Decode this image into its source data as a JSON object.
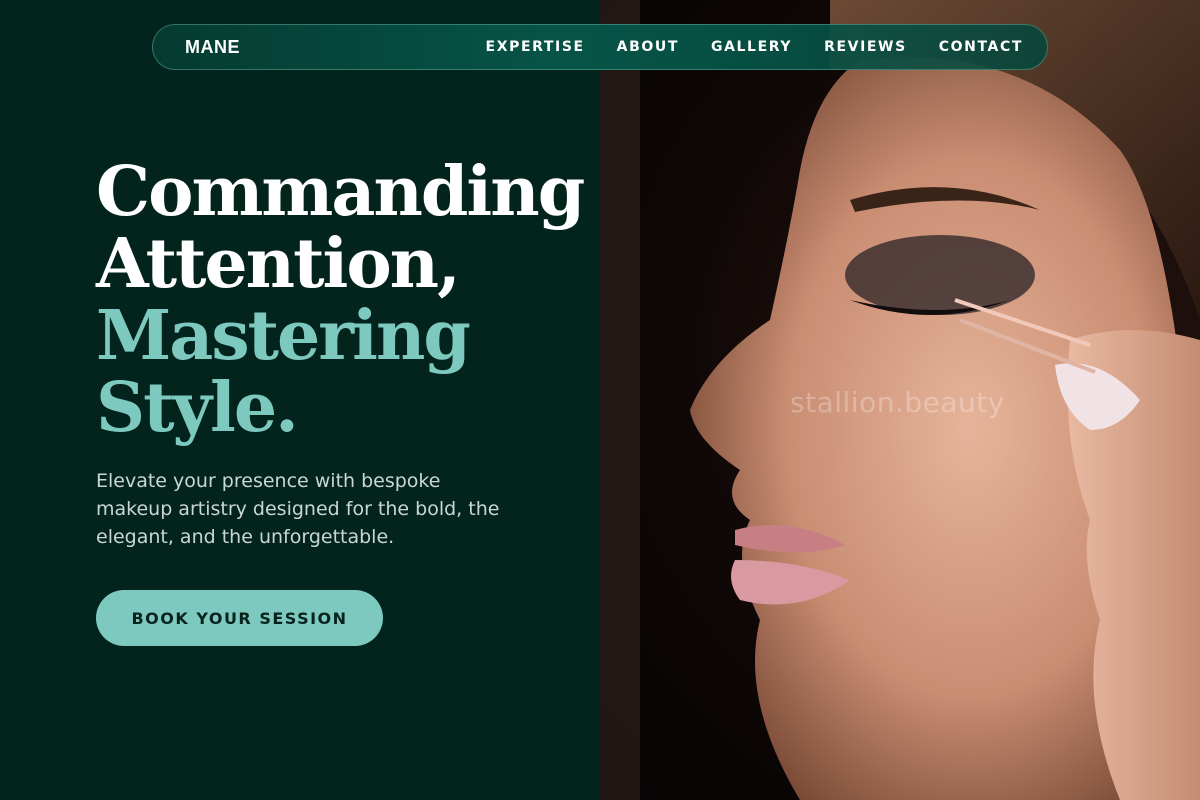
{
  "brand": {
    "name": "MANE"
  },
  "nav": {
    "links": [
      "EXPERTISE",
      "ABOUT",
      "GALLERY",
      "REVIEWS",
      "CONTACT"
    ]
  },
  "hero": {
    "headline_lines": {
      "line1": "Commanding",
      "line2": "Attention,",
      "line3": "Mastering",
      "line4": "Style."
    },
    "subtext": "Elevate your presence with bespoke makeup artistry designed for the bold, the elegant, and the unforgettable.",
    "cta_label": "BOOK YOUR SESSION",
    "image": {
      "description": "close-up makeup application photo",
      "watermark": "stallion.beauty"
    }
  },
  "colors": {
    "background": "#02241c",
    "accent": "#7ec9bf",
    "nav_bg": "#075447",
    "text_light": "#c9d6d2"
  }
}
